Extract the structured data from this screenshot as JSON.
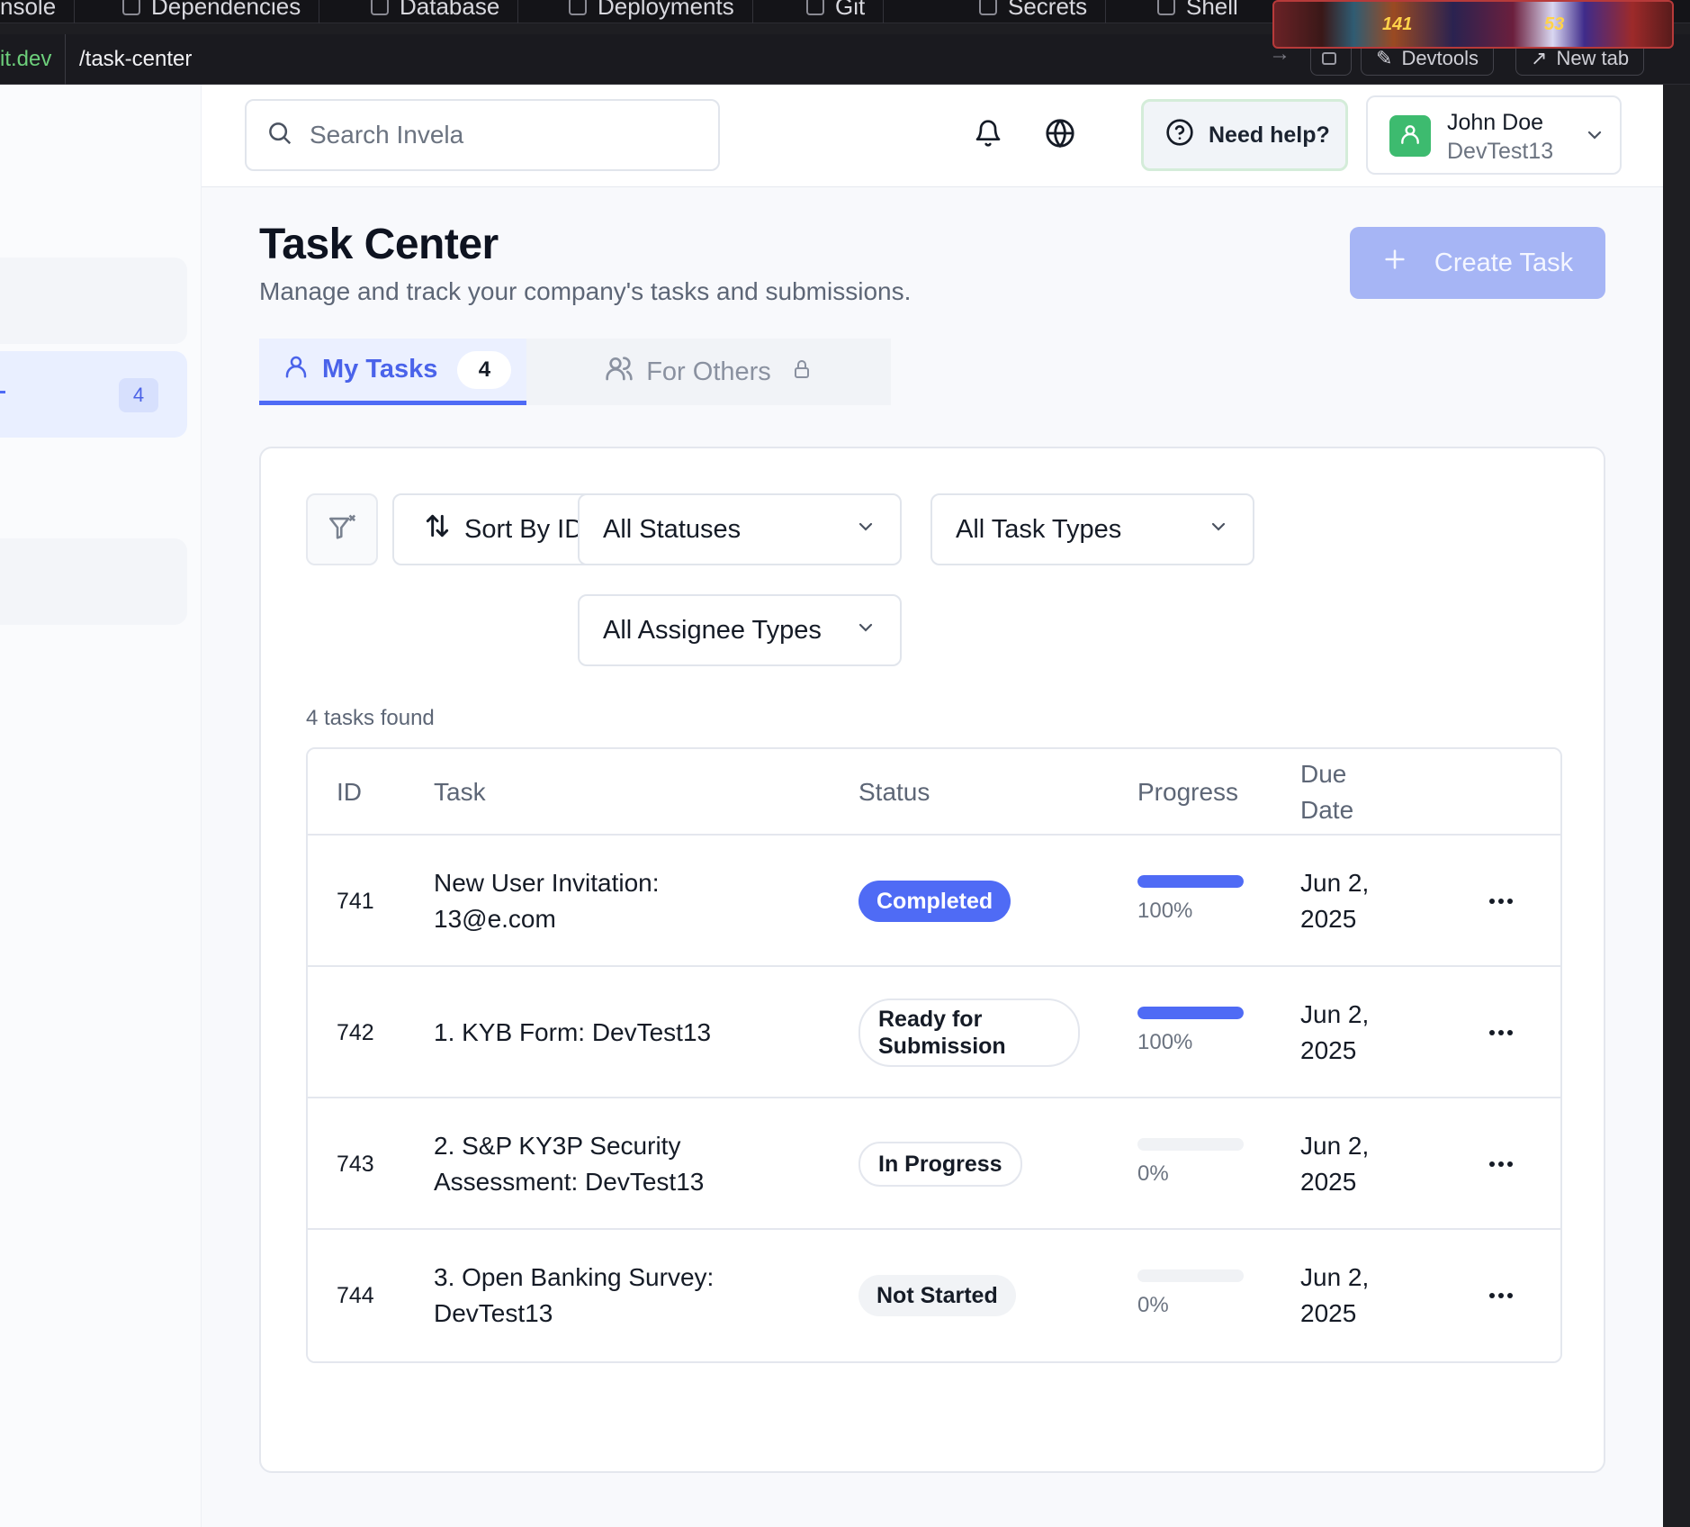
{
  "browser": {
    "ide_tabs": [
      "nsole",
      "Dependencies",
      "Database",
      "Deployments",
      "Git",
      "Secrets",
      "Shell"
    ],
    "address_host": "it.dev",
    "address_path": "/task-center",
    "devtools_label": "Devtools",
    "new_tab_label": "New tab",
    "overlay_numbers": [
      "141",
      "53"
    ]
  },
  "sidebar": {
    "active_badge": "4"
  },
  "header": {
    "search_placeholder": "Search Invela",
    "help_label": "Need help?",
    "user_name": "John Doe",
    "user_org": "DevTest13"
  },
  "page": {
    "title": "Task Center",
    "subtitle": "Manage and track your company's tasks and submissions.",
    "create_button": "Create Task"
  },
  "tabs": {
    "mine_label": "My Tasks",
    "mine_count": "4",
    "others_label": "For Others"
  },
  "filters": {
    "sort_label": "Sort By ID",
    "status_select": "All Statuses",
    "task_type_select": "All Task Types",
    "assignee_select": "All Assignee Types"
  },
  "results": {
    "count_text": "4 tasks found"
  },
  "table": {
    "headers": {
      "id": "ID",
      "task": "Task",
      "status": "Status",
      "progress": "Progress",
      "due_line1": "Due",
      "due_line2": "Date"
    },
    "rows": [
      {
        "id": "741",
        "task": "New User Invitation: 13@e.com",
        "status": "Completed",
        "progress": 100,
        "progress_text": "100%",
        "due": "Jun 2, 2025"
      },
      {
        "id": "742",
        "task": "1. KYB Form: DevTest13",
        "status": "Ready for Submission",
        "progress": 100,
        "progress_text": "100%",
        "due": "Jun 2, 2025"
      },
      {
        "id": "743",
        "task": "2. S&P KY3P Security Assessment: DevTest13",
        "status": "In Progress",
        "progress": 0,
        "progress_text": "0%",
        "due": "Jun 2, 2025"
      },
      {
        "id": "744",
        "task": "3. Open Banking Survey: DevTest13",
        "status": "Not Started",
        "progress": 0,
        "progress_text": "0%",
        "due": "Jun 2, 2025"
      }
    ]
  },
  "colors": {
    "accent": "#4f6bf5",
    "create_button_bg": "#a6b5f5",
    "avatar_bg": "#3dbb6f"
  }
}
